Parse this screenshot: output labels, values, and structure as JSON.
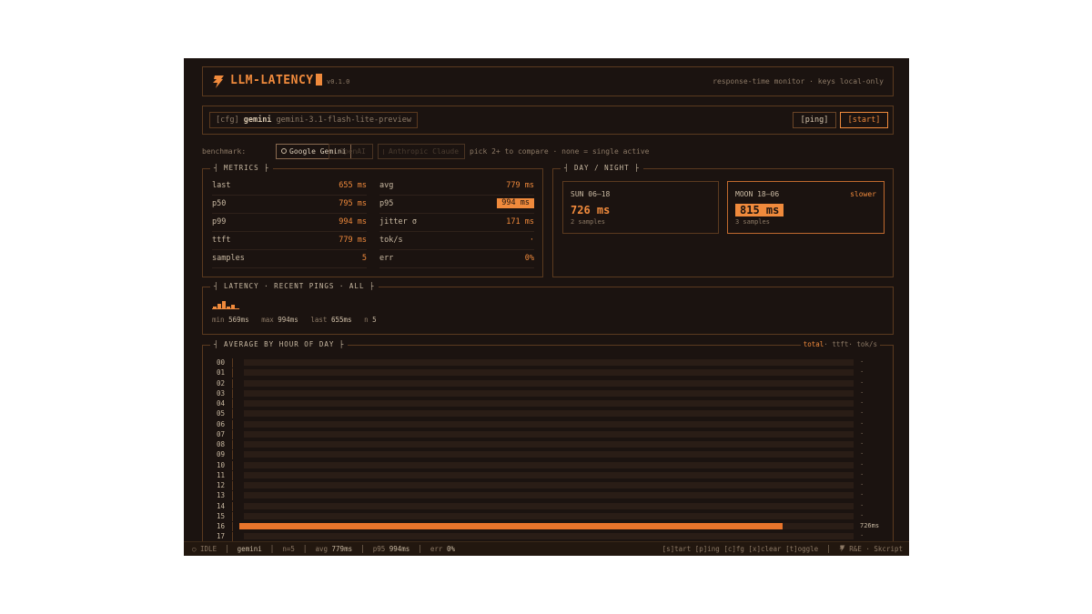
{
  "header": {
    "title": "LLM-LATENCY",
    "version": "v0.1.0",
    "tagline": "response-time monitor · keys local-only"
  },
  "config": {
    "prefix": "[cfg]",
    "provider": "gemini",
    "model": "gemini-3.1-flash-lite-preview",
    "ping_label": "[ping]",
    "start_label": "[start]"
  },
  "benchmark": {
    "label": "benchmark:",
    "options": [
      {
        "label": "Google Gemini",
        "active": true
      },
      {
        "label": "OpenAI",
        "active": false
      },
      {
        "label": "Anthropic Claude",
        "active": false
      }
    ],
    "hint": "pick 2+ to compare · none = single active"
  },
  "metrics": {
    "title": "METRICS",
    "left": [
      {
        "label": "last",
        "value": "655 ms"
      },
      {
        "label": "p50",
        "value": "795 ms"
      },
      {
        "label": "p99",
        "value": "994 ms"
      },
      {
        "label": "ttft",
        "value": "779 ms"
      },
      {
        "label": "samples",
        "value": "5"
      }
    ],
    "right": [
      {
        "label": "avg",
        "value": "779 ms"
      },
      {
        "label": "p95",
        "value": "994 ms"
      },
      {
        "label": "jitter σ",
        "value": "171 ms"
      },
      {
        "label": "tok/s",
        "value": "·"
      },
      {
        "label": "err",
        "value": "0%"
      }
    ]
  },
  "daynight": {
    "title": "DAY / NIGHT",
    "sun": {
      "label": "SUN 06–18",
      "value": "726 ms",
      "samples": "2 samples"
    },
    "moon": {
      "label": "MOON 18–06",
      "value": "815 ms",
      "samples": "3 samples",
      "badge": "slower"
    }
  },
  "latency": {
    "title": "LATENCY · RECENT PINGS · ALL",
    "samples_ms": [
      655,
      795,
      994,
      569,
      779
    ],
    "stats": {
      "min_label": "min",
      "min": "569ms",
      "max_label": "max",
      "max": "994ms",
      "last_label": "last",
      "last": "655ms",
      "n_label": "n",
      "n": "5"
    }
  },
  "hours": {
    "title": "AVERAGE BY HOUR OF DAY",
    "legend": {
      "total": "total",
      "ttft": "ttft",
      "toks": "tok/s"
    },
    "rows": [
      {
        "hour": "00",
        "value": "·",
        "ms": null
      },
      {
        "hour": "01",
        "value": "·",
        "ms": null
      },
      {
        "hour": "02",
        "value": "·",
        "ms": null
      },
      {
        "hour": "03",
        "value": "·",
        "ms": null
      },
      {
        "hour": "04",
        "value": "·",
        "ms": null
      },
      {
        "hour": "05",
        "value": "·",
        "ms": null
      },
      {
        "hour": "06",
        "value": "·",
        "ms": null
      },
      {
        "hour": "07",
        "value": "·",
        "ms": null
      },
      {
        "hour": "08",
        "value": "·",
        "ms": null
      },
      {
        "hour": "09",
        "value": "·",
        "ms": null
      },
      {
        "hour": "10",
        "value": "·",
        "ms": null
      },
      {
        "hour": "11",
        "value": "·",
        "ms": null
      },
      {
        "hour": "12",
        "value": "·",
        "ms": null
      },
      {
        "hour": "13",
        "value": "·",
        "ms": null
      },
      {
        "hour": "14",
        "value": "·",
        "ms": null
      },
      {
        "hour": "15",
        "value": "·",
        "ms": null
      },
      {
        "hour": "16",
        "value": "726ms",
        "ms": 726
      },
      {
        "hour": "17",
        "value": "·",
        "ms": null
      }
    ],
    "scale_max_ms": 815
  },
  "status": {
    "state": "IDLE",
    "provider": "gemini",
    "n": "n=5",
    "avg_label": "avg",
    "avg": "779ms",
    "p95_label": "p95",
    "p95": "994ms",
    "err_label": "err",
    "err": "0%",
    "keys": "[s]tart [p]ing [c]fg [x]clear [t]oggle",
    "credit": "R&E · Skcript"
  },
  "colors": {
    "accent": "#f08a3c",
    "background": "#1b1310",
    "border": "#5b3a1f"
  }
}
